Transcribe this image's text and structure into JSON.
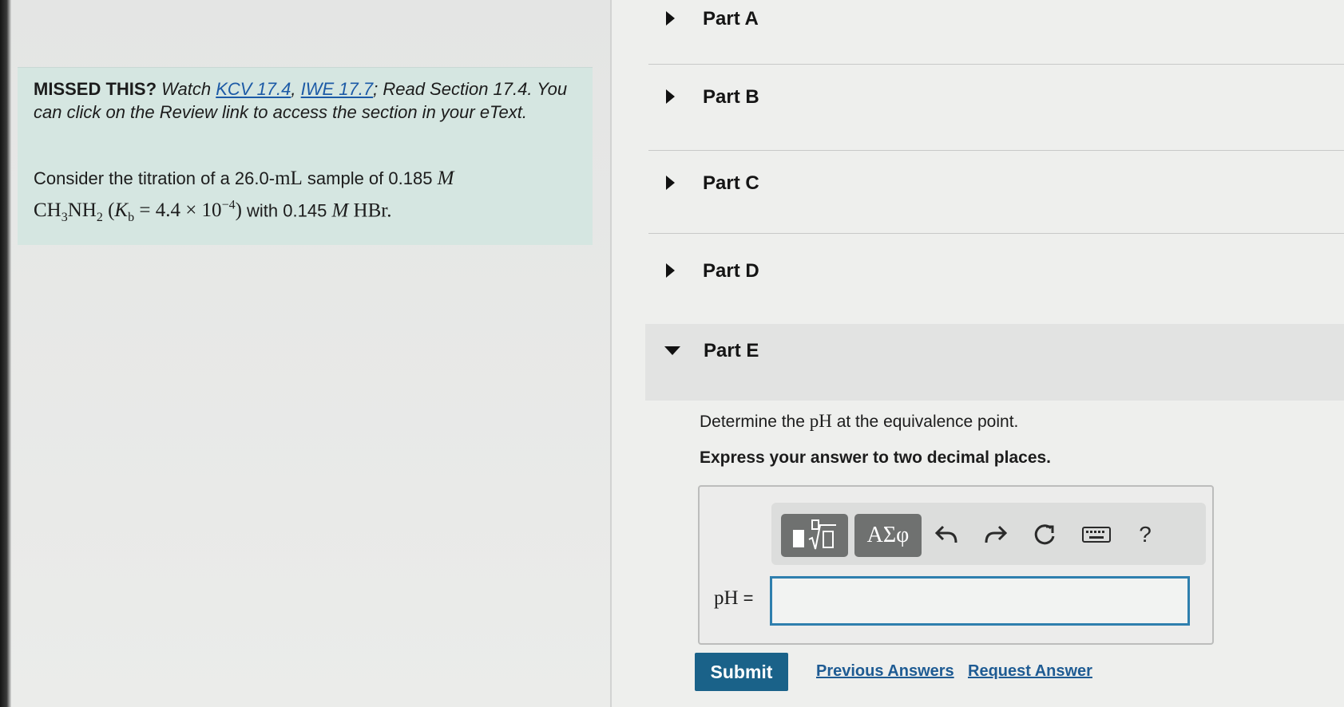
{
  "intro": {
    "lead": "MISSED THIS?",
    "watch": "Watch",
    "link1": "KCV 17.4",
    "comma": ",",
    "link2": "IWE 17.7",
    "rest": "; Read Section 17.4. You can click on the Review link to access the section in your eText."
  },
  "problem": {
    "text_a": "Consider the titration of a 26.0-",
    "unit_ml": "mL",
    "text_b": " sample of 0.185 ",
    "molar": "M",
    "formula_base": "CH",
    "formula_sub1": "3",
    "formula_mid": "NH",
    "formula_sub2": "2",
    "kb_open": " (",
    "kb_k": "K",
    "kb_sub": "b",
    "kb_eq": " = 4.4 × 10",
    "kb_exp": "−4",
    "kb_close": ")",
    "text_c": " with 0.145 ",
    "molar2": "M",
    "acid": " HBr."
  },
  "parts": [
    {
      "label": "Part A",
      "expanded": false
    },
    {
      "label": "Part B",
      "expanded": false
    },
    {
      "label": "Part C",
      "expanded": false
    },
    {
      "label": "Part D",
      "expanded": false
    },
    {
      "label": "Part E",
      "expanded": true
    }
  ],
  "part_e": {
    "question_a": "Determine the ",
    "question_ph": "pH",
    "question_b": " at the equivalence point.",
    "instruction": "Express your answer to two decimal places.",
    "toolbar": {
      "templates_icon": "templates-icon",
      "greek_label": "ΑΣφ",
      "undo_icon": "undo-icon",
      "redo_icon": "redo-icon",
      "reset_icon": "reset-icon",
      "keyboard_icon": "keyboard-icon",
      "help_label": "?"
    },
    "answer_label": "pH",
    "answer_eq": " =",
    "answer_value": "",
    "answer_placeholder": ""
  },
  "actions": {
    "submit": "Submit",
    "previous_answers": "Previous Answers",
    "request_answer": "Request Answer"
  },
  "colors": {
    "info_bg": "#d5e6e1",
    "link": "#1c5aa6",
    "submit_bg": "#1a6289",
    "input_border": "#2f7fae"
  }
}
